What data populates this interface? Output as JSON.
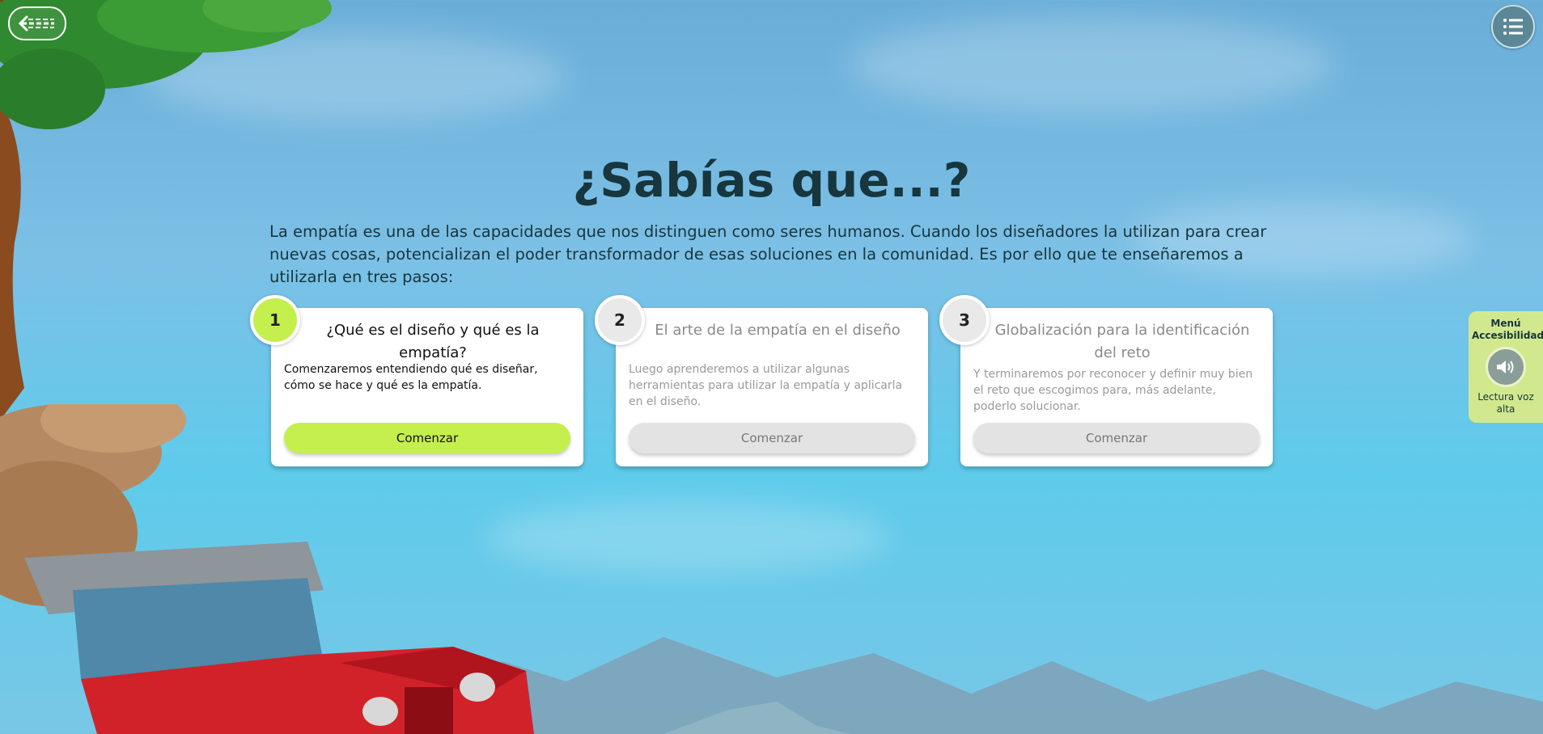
{
  "nav": {
    "back_icon": "arrow-left-icon",
    "menu_icon": "list-menu-icon"
  },
  "page": {
    "title": "¿Sabías que...?",
    "intro": "La empatía es una de las capacidades que nos distinguen como seres humanos. Cuando los diseñadores la utilizan para crear nuevas cosas, potencializan el poder transformador de esas soluciones en la comunidad. Es por ello que te enseñaremos a utilizarla en tres pasos:"
  },
  "steps": [
    {
      "number": "1",
      "title": "¿Qué es el diseño y qué es la empatía?",
      "description": "Comenzaremos entendiendo qué es diseñar, cómo se hace y qué es la empatía.",
      "button": "Comenzar",
      "state": "active"
    },
    {
      "number": "2",
      "title": "El arte de la empatía en el diseño",
      "description": "Luego aprenderemos a utilizar algunas herramientas para utilizar la empatía y aplicarla en el diseño.",
      "button": "Comenzar",
      "state": "locked"
    },
    {
      "number": "3",
      "title": "Globalización para la identificación del reto",
      "description": "Y terminaremos por reconocer y definir muy bien el reto que escogimos para, más adelante, poderlo solucionar.",
      "button": "Comenzar",
      "state": "locked"
    }
  ],
  "accessibility": {
    "title": "Menú Accesibilidad",
    "read_aloud_label": "Lectura voz alta",
    "speaker_icon": "speaker-icon"
  },
  "colors": {
    "accent": "#c5ef4d",
    "title": "#17363d",
    "panel": "#d2e88f"
  }
}
